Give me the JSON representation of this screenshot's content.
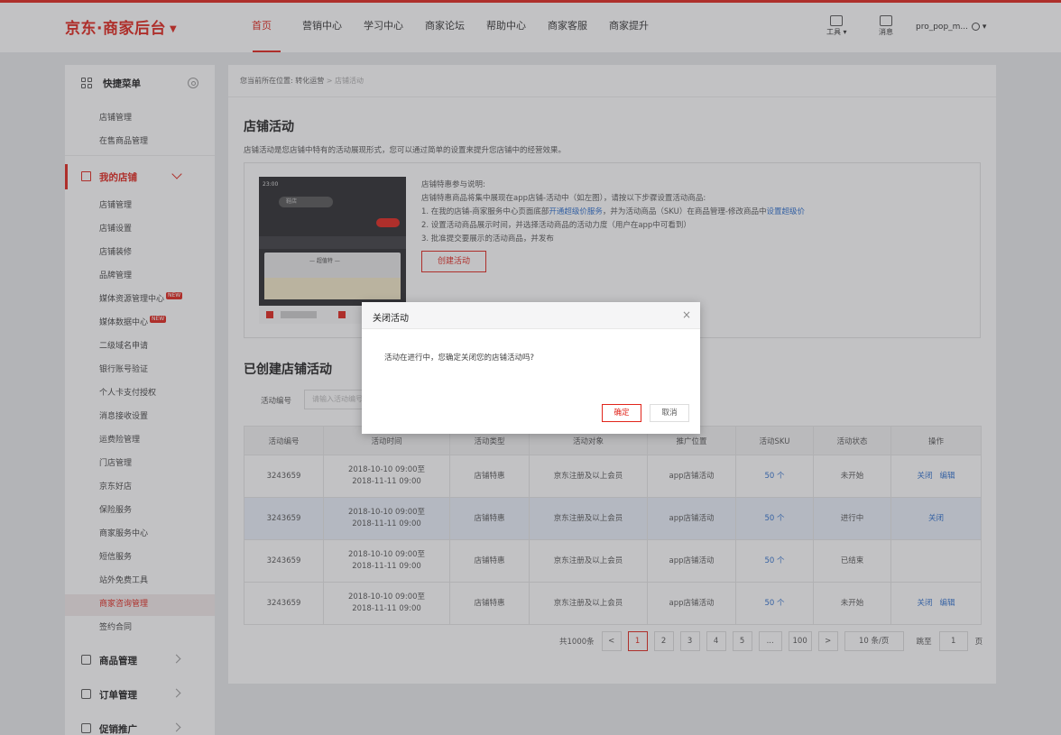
{
  "header": {
    "logo": "京东·商家后台",
    "nav": [
      "首页",
      "营销中心",
      "学习中心",
      "商家论坛",
      "帮助中心",
      "商家客服",
      "商家提升"
    ],
    "active_nav": 0,
    "tools_label": "工具",
    "messages_label": "消息",
    "username": "pro_pop_m..."
  },
  "sidebar": {
    "quick_title": "快捷菜单",
    "quick_links": [
      "店铺管理",
      "在售商品管理"
    ],
    "group_title": "我的店铺",
    "items": [
      {
        "label": "店铺管理"
      },
      {
        "label": "店铺设置"
      },
      {
        "label": "店铺装修"
      },
      {
        "label": "品牌管理"
      },
      {
        "label": "媒体资源管理中心",
        "badge": "NEW"
      },
      {
        "label": "媒体数据中心",
        "badge": "NEW"
      },
      {
        "label": "二级域名申请"
      },
      {
        "label": "银行账号验证"
      },
      {
        "label": "个人卡支付授权"
      },
      {
        "label": "消息接收设置"
      },
      {
        "label": "运费险管理"
      },
      {
        "label": "门店管理"
      },
      {
        "label": "京东好店"
      },
      {
        "label": "保险服务"
      },
      {
        "label": "商家服务中心"
      },
      {
        "label": "短信服务"
      },
      {
        "label": "站外免费工具"
      },
      {
        "label": "商家咨询管理"
      },
      {
        "label": "签约合同"
      }
    ],
    "current_index": 17,
    "groups": [
      "商品管理",
      "订单管理",
      "促销推广"
    ]
  },
  "breadcrumb": {
    "prefix": "您当前所在位置:",
    "parent": "转化运营",
    "current": "店铺活动"
  },
  "section1": {
    "title": "店铺活动",
    "desc": "店铺活动是您店铺中特有的活动展现形式，您可以通过简单的设置来提升您店铺中的经营效果。",
    "intro_title": "店铺特惠参与说明:",
    "intro_line0": "店铺特惠商品将集中展现在app店铺-活动中（如左图），请按以下步骤设置活动商品:",
    "step1_a": "1. 在我的店铺-商家服务中心页面底部",
    "step1_link1": "开通超级价服务",
    "step1_b": "，并为活动商品（SKU）在商品管理-修改商品中",
    "step1_link2": "设置超级价",
    "step2": "2. 设置活动商品展示时间，并选择活动商品的活动力度（用户在app中可看到）",
    "step3": "3. 批准提交要展示的活动商品，并发布",
    "create_btn": "创建活动",
    "phone": {
      "time": "23:00",
      "search": "鞋店",
      "tab_title": "— 超值特 —"
    }
  },
  "section2": {
    "title": "已创建店铺活动",
    "filter_label": "活动编号",
    "filter_placeholder": "请输入活动编号"
  },
  "table": {
    "columns": [
      "活动编号",
      "活动时间",
      "活动类型",
      "活动对象",
      "推广位置",
      "活动SKU",
      "活动状态",
      "操作"
    ],
    "rows": [
      {
        "id": "3243659",
        "start": "2018-10-10 09:00至",
        "end": "2018-11-11 09:00",
        "type": "店铺特惠",
        "target": "京东注册及以上会员",
        "position": "app店铺活动",
        "sku": "50 个",
        "status": "未开始",
        "ops": [
          "关闭",
          "编辑"
        ]
      },
      {
        "id": "3243659",
        "start": "2018-10-10 09:00至",
        "end": "2018-11-11 09:00",
        "type": "店铺特惠",
        "target": "京东注册及以上会员",
        "position": "app店铺活动",
        "sku": "50 个",
        "status": "进行中",
        "ops": [
          "关闭"
        ]
      },
      {
        "id": "3243659",
        "start": "2018-10-10 09:00至",
        "end": "2018-11-11 09:00",
        "type": "店铺特惠",
        "target": "京东注册及以上会员",
        "position": "app店铺活动",
        "sku": "50 个",
        "status": "已结束",
        "ops": []
      },
      {
        "id": "3243659",
        "start": "2018-10-10 09:00至",
        "end": "2018-11-11 09:00",
        "type": "店铺特惠",
        "target": "京东注册及以上会员",
        "position": "app店铺活动",
        "sku": "50 个",
        "status": "未开始",
        "ops": [
          "关闭",
          "编辑"
        ]
      }
    ],
    "highlight_row": 1
  },
  "pagination": {
    "total": "共1000条",
    "prev": "<",
    "pages": [
      "1",
      "2",
      "3",
      "4",
      "5",
      "...",
      "100"
    ],
    "current_page": "1",
    "next": ">",
    "page_size": "10 条/页",
    "jump_label": "跳至",
    "jump_value": "1",
    "jump_unit": "页"
  },
  "modal": {
    "title": "关闭活动",
    "close": "×",
    "message": "活动在进行中，您确定关闭您的店铺活动吗?",
    "ok": "确定",
    "cancel": "取消"
  },
  "colors": {
    "brand": "#e1251b",
    "link": "#2f70ce"
  }
}
